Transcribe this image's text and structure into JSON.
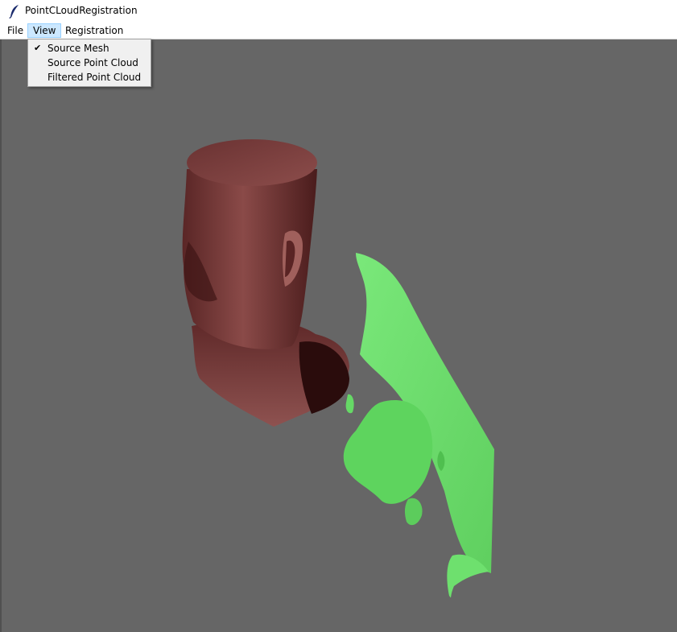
{
  "window": {
    "title": "PointCLoudRegistration",
    "icon": "feather-icon"
  },
  "menubar": {
    "items": [
      {
        "label": "File"
      },
      {
        "label": "View"
      },
      {
        "label": "Registration"
      }
    ]
  },
  "view_menu": {
    "items": [
      {
        "label": "Source Mesh",
        "checked": true,
        "check_glyph": "✔"
      },
      {
        "label": "Source Point Cloud",
        "checked": false
      },
      {
        "label": "Filtered Point Cloud",
        "checked": false
      }
    ]
  },
  "viewport": {
    "background": "#666666",
    "source_mesh_color": "#7a3b3b",
    "point_cloud_color": "#6ee06e"
  }
}
